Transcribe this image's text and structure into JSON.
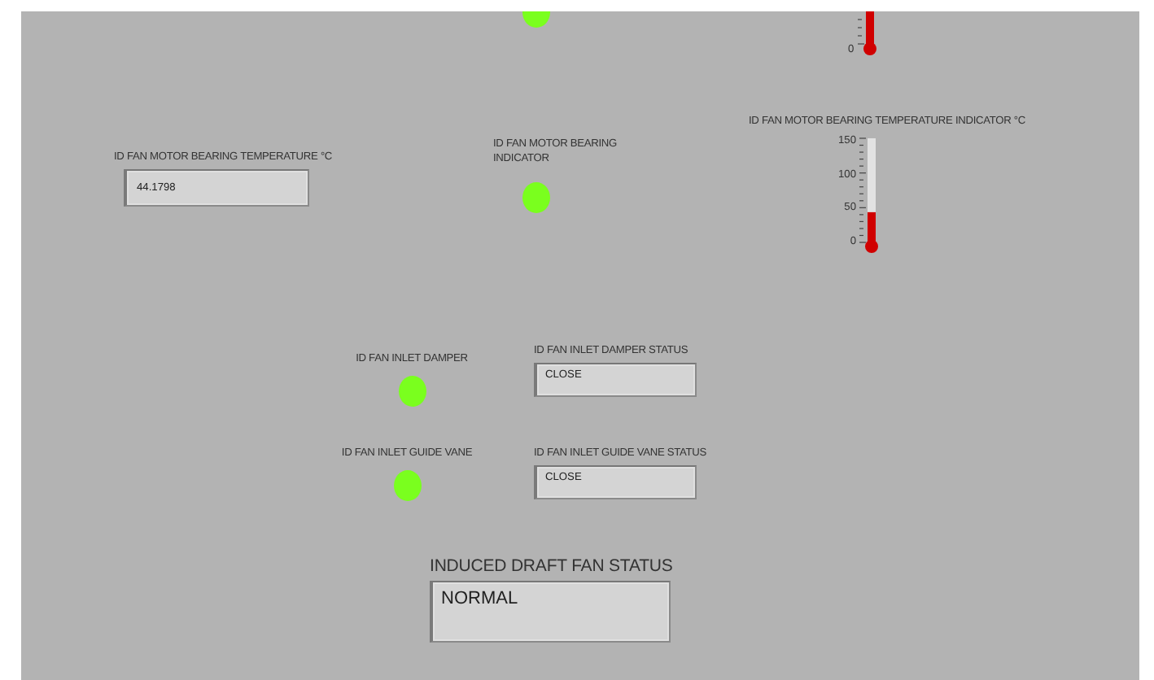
{
  "top_partial": {
    "led": {
      "on": true
    },
    "thermometer": {
      "ticks": [
        "0"
      ]
    }
  },
  "controls": [
    {
      "kind": "numeric",
      "label": "ID FAN MOTOR BEARING TEMPERATURE  °C",
      "value": "44.1798"
    },
    {
      "kind": "led",
      "label": "ID FAN MOTOR BEARING INDICATOR",
      "on": true
    },
    {
      "kind": "thermometer",
      "label": "ID FAN MOTOR BEARING TEMPERATURE INDICATOR  °C",
      "ticks": [
        "150",
        "100",
        "50",
        "0"
      ],
      "level": 0.29
    },
    {
      "kind": "led",
      "label": "ID FAN INLET DAMPER",
      "on": true
    },
    {
      "kind": "string",
      "label": "ID FAN INLET DAMPER STATUS",
      "value": "CLOSE"
    },
    {
      "kind": "led",
      "label": "ID FAN INLET GUIDE VANE",
      "on": true
    },
    {
      "kind": "string",
      "label": "ID FAN INLET GUIDE VANE STATUS",
      "value": "CLOSE"
    },
    {
      "kind": "bigstring",
      "label": "INDUCED DRAFT FAN STATUS",
      "value": "NORMAL"
    }
  ]
}
